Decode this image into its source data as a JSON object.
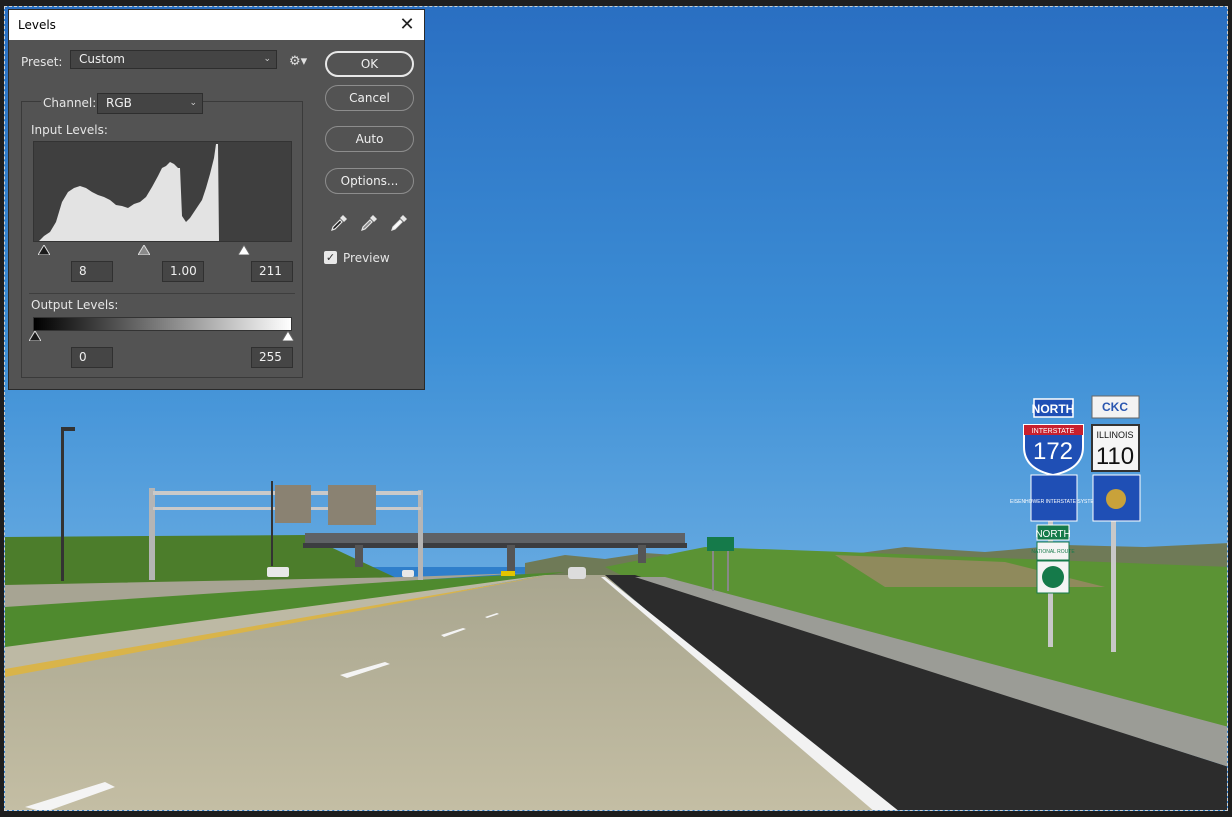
{
  "dialog": {
    "title": "Levels",
    "close_glyph": "✕",
    "preset": {
      "label": "Preset:",
      "value": "Custom"
    },
    "channel": {
      "label": "Channel:",
      "value": "RGB"
    },
    "input_levels": {
      "label": "Input Levels:",
      "black": "8",
      "gamma": "1.00",
      "white": "211"
    },
    "output_levels": {
      "label": "Output Levels:",
      "black": "0",
      "white": "255"
    },
    "buttons": {
      "ok": "OK",
      "cancel": "Cancel",
      "auto": "Auto",
      "options": "Options..."
    },
    "preview": {
      "label": "Preview",
      "checked": true,
      "check_glyph": "✓"
    },
    "icons": {
      "gear": "gear-icon",
      "eyedroppers": [
        "black-point-eyedropper-icon",
        "gray-point-eyedropper-icon",
        "white-point-eyedropper-icon"
      ]
    }
  },
  "photo_signs": {
    "north_top": "NORTH",
    "ckc": "CKC",
    "interstate_band": "INTERSTATE",
    "interstate_number": "172",
    "illinois": "ILLINOIS",
    "illinois_number": "110",
    "eisenhower": "EISENHOWER INTERSTATE SYSTEM",
    "north_lower": "NORTH",
    "national_route": "NATIONAL ROUTE"
  },
  "colors": {
    "dialog_bg": "#535353",
    "sky": "#2f7fcb",
    "grass": "#4f8a2e",
    "road": "#b9b49a",
    "interstate_red": "#c8202e",
    "interstate_blue": "#1f4fb5",
    "sign_green": "#157a4a"
  }
}
